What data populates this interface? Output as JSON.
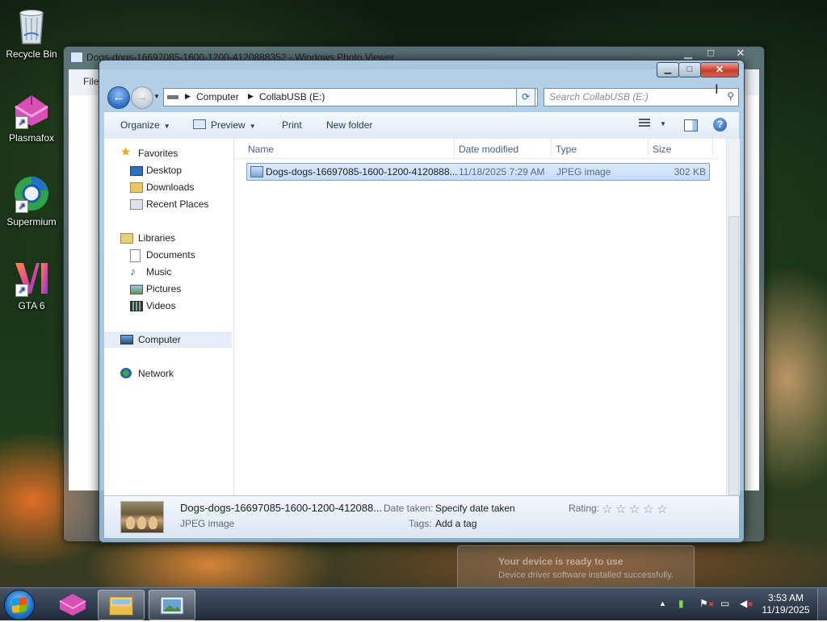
{
  "desktop": {
    "icons": [
      {
        "label": "Recycle Bin",
        "icon": "recycle-bin-icon"
      },
      {
        "label": "Plasmafox",
        "icon": "plasmafox-icon"
      },
      {
        "label": "Supermium",
        "icon": "supermium-icon"
      },
      {
        "label": "GTA 6",
        "icon": "gta6-icon"
      }
    ]
  },
  "photo_viewer": {
    "title": "Dogs-dogs-16697085-1600-1200-4120888352 - Windows Photo Viewer",
    "menu_file": "File"
  },
  "explorer": {
    "address": {
      "crumbs": [
        "Computer",
        "CollabUSB (E:)"
      ]
    },
    "search": {
      "placeholder": "Search CollabUSB (E:)"
    },
    "toolbar": {
      "organize": "Organize",
      "preview": "Preview",
      "print": "Print",
      "new_folder": "New folder"
    },
    "nav": {
      "favorites": "Favorites",
      "desktop": "Desktop",
      "downloads": "Downloads",
      "recent_places": "Recent Places",
      "libraries": "Libraries",
      "documents": "Documents",
      "music": "Music",
      "pictures": "Pictures",
      "videos": "Videos",
      "computer": "Computer",
      "network": "Network"
    },
    "columns": {
      "name": "Name",
      "date_modified": "Date modified",
      "type": "Type",
      "size": "Size"
    },
    "files": [
      {
        "name": "Dogs-dogs-16697085-1600-1200-4120888...",
        "date_modified": "11/18/2025 7:29 AM",
        "type": "JPEG image",
        "size": "302 KB"
      }
    ],
    "details": {
      "file_name": "Dogs-dogs-16697085-1600-1200-412088...",
      "file_type": "JPEG image",
      "date_taken_label": "Date taken:",
      "date_taken_value": "Specify date taken",
      "tags_label": "Tags:",
      "tags_value": "Add a tag",
      "rating_label": "Rating:",
      "rating_value": 0,
      "rating_max": 5
    }
  },
  "notification": {
    "text": "Your device is ready to use",
    "subtext": "Device driver software installed successfully."
  },
  "taskbar": {
    "time": "3:53 AM",
    "date": "11/19/2025"
  },
  "colors": {
    "selection": "#cce4fc",
    "close_button": "#c4402c",
    "link_text": "#1e395b"
  }
}
